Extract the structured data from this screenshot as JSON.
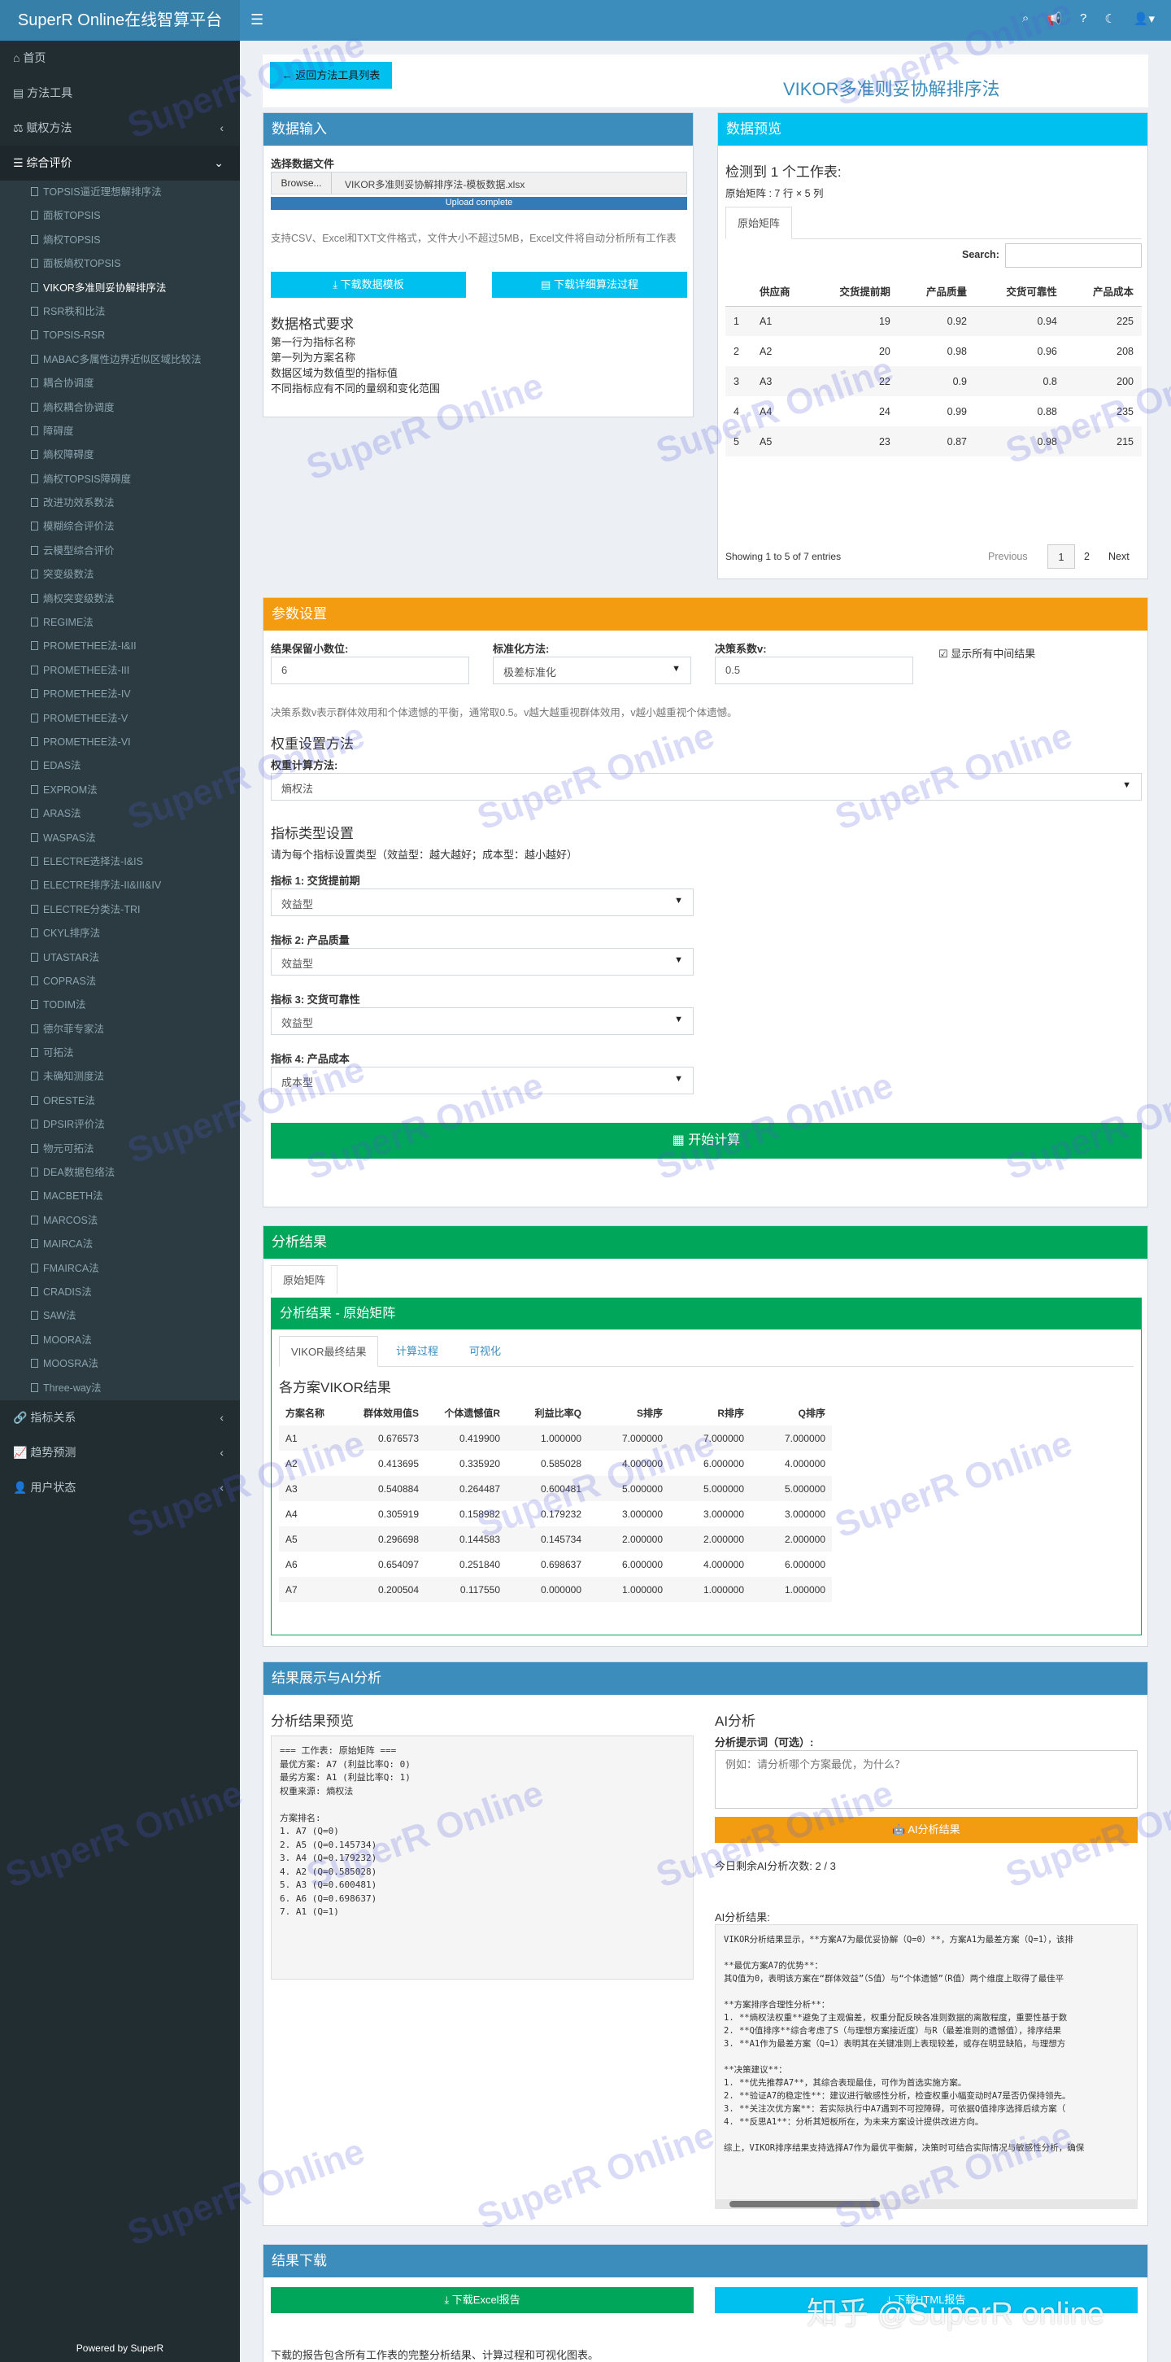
{
  "app": {
    "brand": "SuperR Online在线智算平台"
  },
  "topbar": {
    "icons": [
      "hamburger-icon",
      "search-icon",
      "bullhorn-icon",
      "question-icon",
      "moon-icon",
      "user-icon"
    ]
  },
  "sidebar": {
    "top_items": [
      {
        "label": "首页",
        "icon": "home-icon"
      },
      {
        "label": "方法工具",
        "icon": "book-icon"
      },
      {
        "label": "赋权方法",
        "icon": "balance-icon",
        "caret": "‹"
      },
      {
        "label": "综合评价",
        "icon": "list-icon",
        "caret": "‹"
      }
    ],
    "sub_items": [
      "TOPSIS逼近理想解排序法",
      "面板TOPSIS",
      "熵权TOPSIS",
      "面板熵权TOPSIS",
      "VIKOR多准则妥协解排序法",
      "RSR秩和比法",
      "TOPSIS-RSR",
      "MABAC多属性边界近似区域比较法",
      "耦合协调度",
      "熵权耦合协调度",
      "障碍度",
      "熵权障碍度",
      "熵权TOPSIS障碍度",
      "改进功效系数法",
      "模糊综合评价法",
      "云模型综合评价",
      "突变级数法",
      "熵权突变级数法",
      "REGIME法",
      "PROMETHEE法-I&II",
      "PROMETHEE法-III",
      "PROMETHEE法-IV",
      "PROMETHEE法-V",
      "PROMETHEE法-VI",
      "EDAS法",
      "EXPROM法",
      "ARAS法",
      "WASPAS法",
      "ELECTRE选择法-I&IS",
      "ELECTRE排序法-II&III&IV",
      "ELECTRE分类法-TRI",
      "CKYL排序法",
      "UTASTAR法",
      "COPRAS法",
      "TODIM法",
      "德尔菲专家法",
      "可拓法",
      "未确知测度法",
      "ORESTE法",
      "DPSIR评价法",
      "物元可拓法",
      "DEA数据包络法",
      "MACBETH法",
      "MARCOS法",
      "MAIRCA法",
      "FMAIRCA法",
      "CRADIS法",
      "SAW法",
      "MOORA法",
      "MOOSRA法",
      "Three-way法"
    ],
    "active_sub": "VIKOR多准则妥协解排序法",
    "bottom_items": [
      {
        "label": "指标关系",
        "icon": "link-icon",
        "caret": "‹"
      },
      {
        "label": "趋势预测",
        "icon": "chart-icon",
        "caret": "‹"
      },
      {
        "label": "用户状态",
        "icon": "user-icon",
        "caret": "‹"
      }
    ],
    "powered": "Powered by SuperR"
  },
  "header": {
    "back_label": "← 返回方法工具列表",
    "title": "VIKOR多准则妥协解排序法"
  },
  "input_box": {
    "title": "数据输入",
    "file_label": "选择数据文件",
    "browse": "Browse...",
    "file_name": "VIKOR多准则妥协解排序法-模板数据.xlsx",
    "upload_status": "Upload complete",
    "upload_progress": 1.0,
    "help": "支持CSV、Excel和TXT文件格式，文件大小不超过5MB，Excel文件将自动分析所有工作表",
    "download_template": "下载数据模板",
    "download_process": "下载详细算法过程",
    "format_title": "数据格式要求",
    "format_rules": [
      "第一行为指标名称",
      "第一列为方案名称",
      "数据区域为数值型的指标值",
      "不同指标应有不同的量纲和变化范围"
    ]
  },
  "preview_box": {
    "title": "数据预览",
    "detected": "检测到 1 个工作表:",
    "matrix_info": "原始矩阵 : 7 行 × 5 列",
    "tab": "原始矩阵",
    "search_label": "Search:",
    "columns": [
      "",
      "供应商",
      "交货提前期",
      "产品质量",
      "交货可靠性",
      "产品成本"
    ],
    "rows": [
      [
        "1",
        "A1",
        "19",
        "0.92",
        "0.94",
        "225"
      ],
      [
        "2",
        "A2",
        "20",
        "0.98",
        "0.96",
        "208"
      ],
      [
        "3",
        "A3",
        "22",
        "0.9",
        "0.8",
        "200"
      ],
      [
        "4",
        "A4",
        "24",
        "0.99",
        "0.88",
        "235"
      ],
      [
        "5",
        "A5",
        "23",
        "0.87",
        "0.98",
        "215"
      ]
    ],
    "info": "Showing 1 to 5 of 7 entries",
    "pager": {
      "prev": "Previous",
      "p1": "1",
      "p2": "2",
      "next": "Next"
    }
  },
  "params_box": {
    "title": "参数设置",
    "decimals_label": "结果保留小数位:",
    "decimals_value": "6",
    "standard_label": "标准化方法:",
    "standard_value": "极差标准化",
    "v_label": "决策系数v:",
    "v_value": "0.5",
    "show_mid_label": "显示所有中间结果",
    "show_mid_checked": "☑",
    "v_help": "决策系数v表示群体效用和个体遗憾的平衡，通常取0.5。v越大越重视群体效用，v越小越重视个体遗憾。",
    "weight_title": "权重设置方法",
    "weight_calc_label": "权重计算方法:",
    "weight_calc_value": "熵权法",
    "type_title": "指标类型设置",
    "type_help": "请为每个指标设置类型（效益型：越大越好；成本型：越小越好）",
    "indicators": [
      {
        "label": "指标 1: 交货提前期",
        "value": "效益型"
      },
      {
        "label": "指标 2: 产品质量",
        "value": "效益型"
      },
      {
        "label": "指标 3: 交货可靠性",
        "value": "效益型"
      },
      {
        "label": "指标 4: 产品成本",
        "value": "成本型"
      }
    ],
    "start_label": "开始计算"
  },
  "results_box": {
    "title": "分析结果",
    "outer_tab": "原始矩阵",
    "inner_title": "分析结果 - 原始矩阵",
    "tabs": [
      "VIKOR最终结果",
      "计算过程",
      "可视化"
    ],
    "table_title": "各方案VIKOR结果",
    "columns": [
      "方案名称",
      "群体效用值S",
      "个体遗憾值R",
      "利益比率Q",
      "S排序",
      "R排序",
      "Q排序"
    ],
    "rows": [
      [
        "A1",
        "0.676573",
        "0.419900",
        "1.000000",
        "7.000000",
        "7.000000",
        "7.000000"
      ],
      [
        "A2",
        "0.413695",
        "0.335920",
        "0.585028",
        "4.000000",
        "6.000000",
        "4.000000"
      ],
      [
        "A3",
        "0.540884",
        "0.264487",
        "0.600481",
        "5.000000",
        "5.000000",
        "5.000000"
      ],
      [
        "A4",
        "0.305919",
        "0.158982",
        "0.179232",
        "3.000000",
        "3.000000",
        "3.000000"
      ],
      [
        "A5",
        "0.296698",
        "0.144583",
        "0.145734",
        "2.000000",
        "2.000000",
        "2.000000"
      ],
      [
        "A6",
        "0.654097",
        "0.251840",
        "0.698637",
        "6.000000",
        "4.000000",
        "6.000000"
      ],
      [
        "A7",
        "0.200504",
        "0.117550",
        "0.000000",
        "1.000000",
        "1.000000",
        "1.000000"
      ]
    ]
  },
  "ai_box": {
    "title": "结果展示与AI分析",
    "preview_title": "分析结果预览",
    "preview_text": "=== 工作表: 原始矩阵 ===\n最优方案: A7 (利益比率Q: 0)\n最劣方案: A1 (利益比率Q: 1)\n权重来源: 熵权法\n\n方案排名:\n1. A7 (Q=0)\n2. A5 (Q=0.145734)\n3. A4 (Q=0.179232)\n4. A2 (Q=0.585028)\n5. A3 (Q=0.600481)\n6. A6 (Q=0.698637)\n7. A1 (Q=1)",
    "ai_title": "AI分析",
    "prompt_label": "分析提示词（可选）:",
    "prompt_placeholder": "例如：请分析哪个方案最优，为什么？",
    "ai_button": "AI分析结果",
    "remaining": "今日剩余AI分析次数: 2 / 3",
    "ai_result_label": "AI分析结果:",
    "ai_result_text": "VIKOR分析结果显示，**方案A7为最优妥协解（Q=0）**，方案A1为最差方案（Q=1），该排\n\n**最优方案A7的优势**：\n其Q值为0，表明该方案在“群体效益”（S值）与“个体遗憾”（R值）两个维度上取得了最佳平\n\n**方案排序合理性分析**：\n1. **熵权法权重**避免了主观偏差，权重分配反映各准则数据的离散程度，重要性基于数\n2. **Q值排序**综合考虑了S（与理想方案接近度）与R（最差准则的遗憾值），排序结果\n3. **A1作为最差方案（Q=1）表明其在关键准则上表现较差，或存在明显缺陷，与理想方\n\n**决策建议**：\n1. **优先推荐A7**，其综合表现最佳，可作为首选实施方案。\n2. **验证A7的稳定性**：建议进行敏感性分析，检查权重小幅变动时A7是否仍保持领先。\n3. **关注次优方案**：若实际执行中A7遇到不可控障碍，可依据Q值排序选择后续方案（\n4. **反思A1**：分析其短板所在，为未来方案设计提供改进方向。\n\n综上，VIKOR排序结果支持选择A7作为最优平衡解，决策时可结合实际情况与敏感性分析，确保"
  },
  "download_box": {
    "title": "结果下载",
    "excel_label": "下载Excel报告",
    "html_label": "下载HTML报告",
    "note": "下载的报告包含所有工作表的完整分析结果、计算过程和可视化图表。"
  },
  "watermark": {
    "text": "SuperR Online",
    "zhihu": "知乎 @SuperR online"
  },
  "colors": {
    "primary": "#3c8dbc",
    "info": "#00c0ef",
    "warning": "#f39c12",
    "success": "#00a65a",
    "sidebar": "#222d32"
  }
}
